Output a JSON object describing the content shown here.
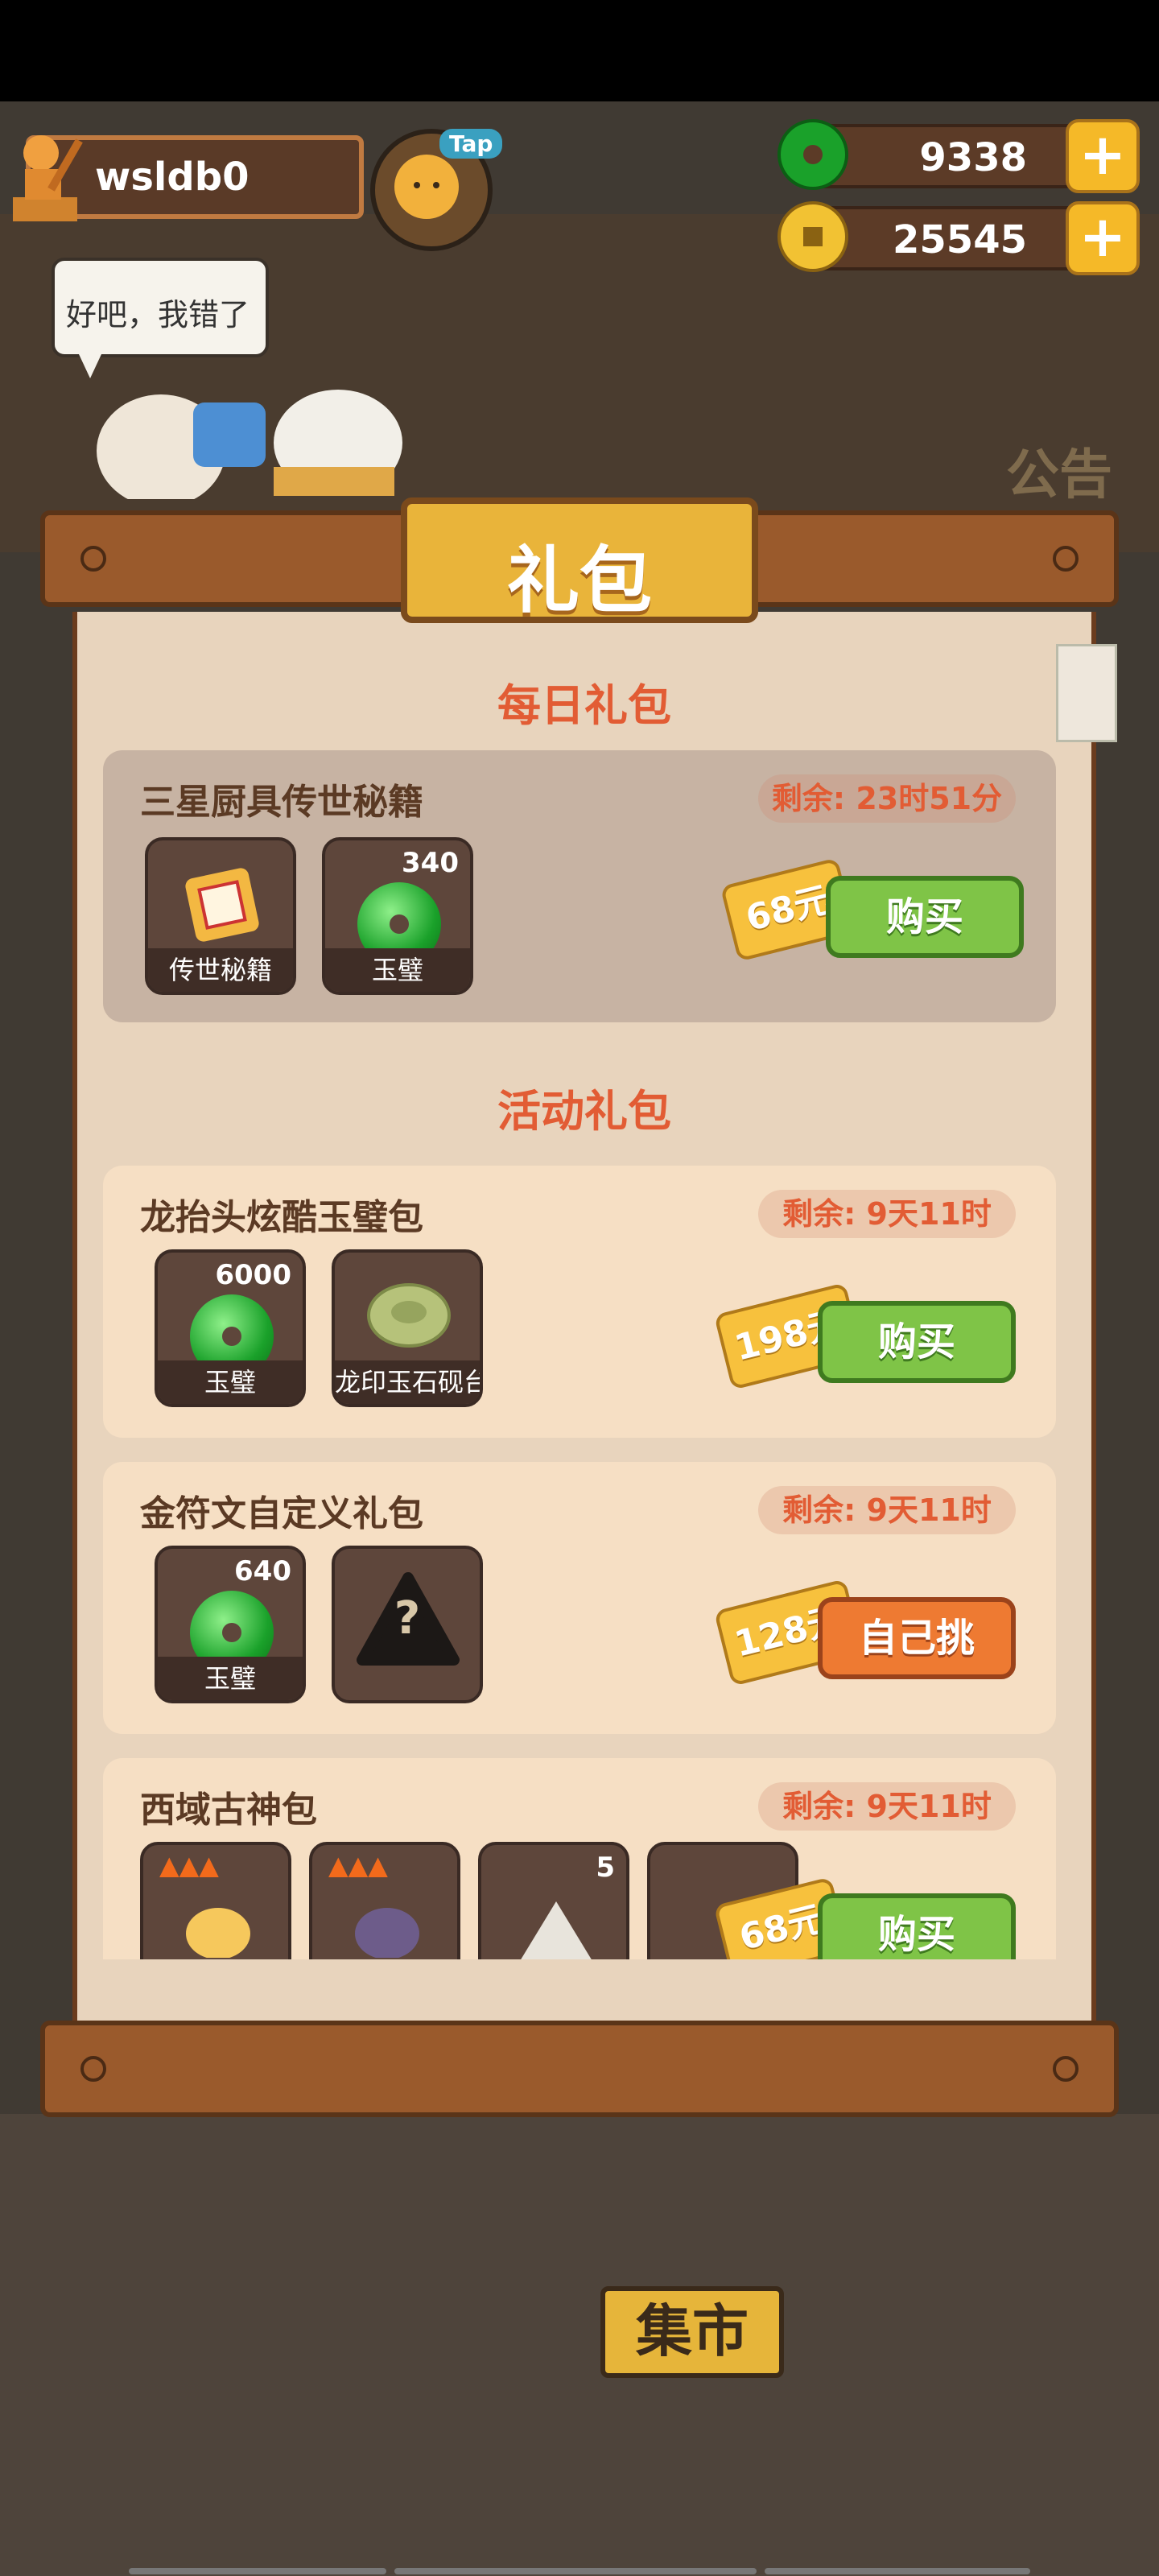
{
  "hud": {
    "player_name": "wsldb0",
    "tap_label": "Tap",
    "jade": "9338",
    "coins": "25545",
    "plus": "+"
  },
  "speech": "好吧，我错了",
  "background": {
    "market_sign": "集市",
    "notice_sign": "公告"
  },
  "panel": {
    "title": "礼包",
    "daily_section": "每日礼包",
    "event_section": "活动礼包",
    "daily_pack": {
      "name": "三星厨具传世秘籍",
      "timer": "剩余: 23时51分",
      "items": [
        {
          "label": "传世秘籍",
          "count": ""
        },
        {
          "label": "玉璧",
          "count": "340"
        }
      ],
      "price": "68元",
      "action": "购买"
    },
    "event_packs": [
      {
        "name": "龙抬头炫酷玉璧包",
        "timer": "剩余: 9天11时",
        "items": [
          {
            "label": "玉璧",
            "count": "6000"
          },
          {
            "label": "龙印玉石砚台",
            "count": ""
          }
        ],
        "price": "198元",
        "action": "购买"
      },
      {
        "name": "金符文自定义礼包",
        "timer": "剩余: 9天11时",
        "items": [
          {
            "label": "玉璧",
            "count": "640"
          },
          {
            "label": "",
            "count": "?"
          }
        ],
        "price": "128元",
        "action": "自己挑"
      },
      {
        "name": "西域古神包",
        "timer": "剩余: 9天11时",
        "items": [
          {
            "label": "",
            "count": ""
          },
          {
            "label": "",
            "count": ""
          },
          {
            "label": "",
            "count": "5"
          }
        ],
        "price": "68元",
        "action": "购买"
      }
    ]
  },
  "colors": {
    "accent_red": "#e25c34",
    "buy_green": "#7fc447",
    "pick_orange": "#ee7a32",
    "price_yellow": "#f7c13d"
  }
}
